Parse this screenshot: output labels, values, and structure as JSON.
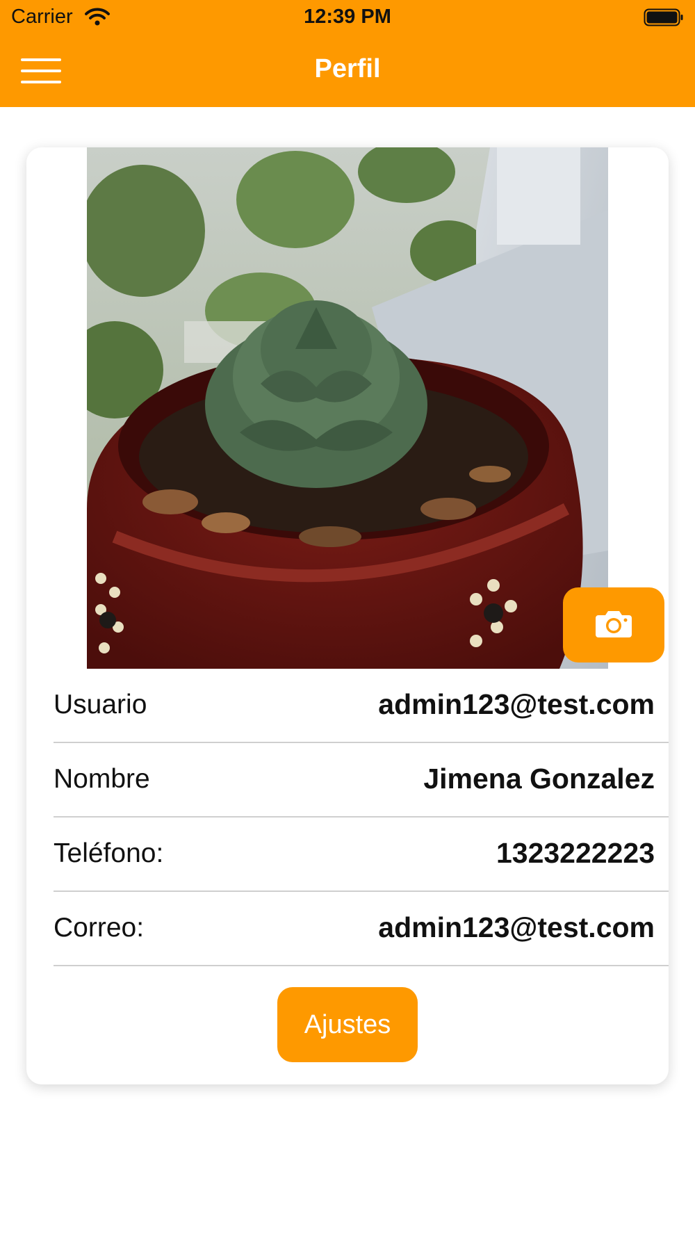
{
  "status_bar": {
    "carrier": "Carrier",
    "time": "12:39 PM",
    "wifi_icon": "wifi-icon",
    "battery_icon": "battery-icon"
  },
  "nav": {
    "title": "Perfil",
    "menu_icon": "hamburger-menu-icon"
  },
  "profile": {
    "photo_alt": "Foto de perfil",
    "camera_icon": "camera-icon",
    "rows": [
      {
        "label": "Usuario",
        "value": "admin123@test.com"
      },
      {
        "label": "Nombre",
        "value": "Jimena Gonzalez"
      },
      {
        "label": "Teléfono:",
        "value": "1323222223"
      },
      {
        "label": "Correo:",
        "value": "admin123@test.com"
      }
    ],
    "settings_label": "Ajustes"
  },
  "colors": {
    "accent": "#fe9900",
    "background": "#ffffff",
    "text": "#111111",
    "divider": "#cfcfcf"
  }
}
